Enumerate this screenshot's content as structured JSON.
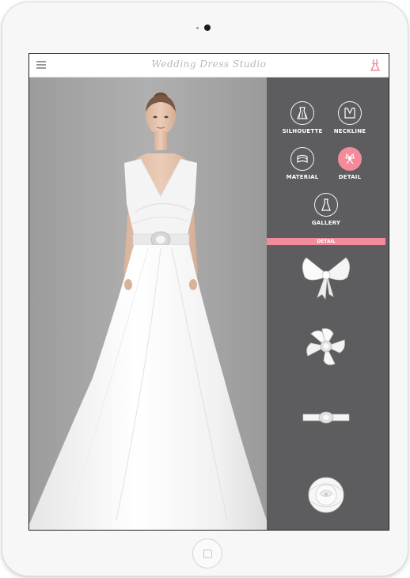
{
  "app": {
    "title": "Wedding Dress Studio"
  },
  "topbar": {
    "menu_icon": "hamburger-menu-icon",
    "dress_icon": "dress-icon"
  },
  "categories": [
    {
      "label": "SILHOUETTE",
      "icon": "silhouette-icon",
      "active": false
    },
    {
      "label": "NECKLINE",
      "icon": "neckline-icon",
      "active": false
    },
    {
      "label": "MATERIAL",
      "icon": "material-icon",
      "active": false
    },
    {
      "label": "DETAIL",
      "icon": "detail-icon",
      "active": true
    },
    {
      "label": "GALLERY",
      "icon": "gallery-icon",
      "active": false
    }
  ],
  "detail_panel": {
    "header": "DETAIL",
    "items": [
      "bow-detail",
      "pinwheel-brooch-detail",
      "jeweled-belt-detail",
      "flower-detail"
    ]
  },
  "colors": {
    "accent": "#f28b9b",
    "panel_bg": "#5d5d5f",
    "stage_bg": "#a3a3a3"
  }
}
